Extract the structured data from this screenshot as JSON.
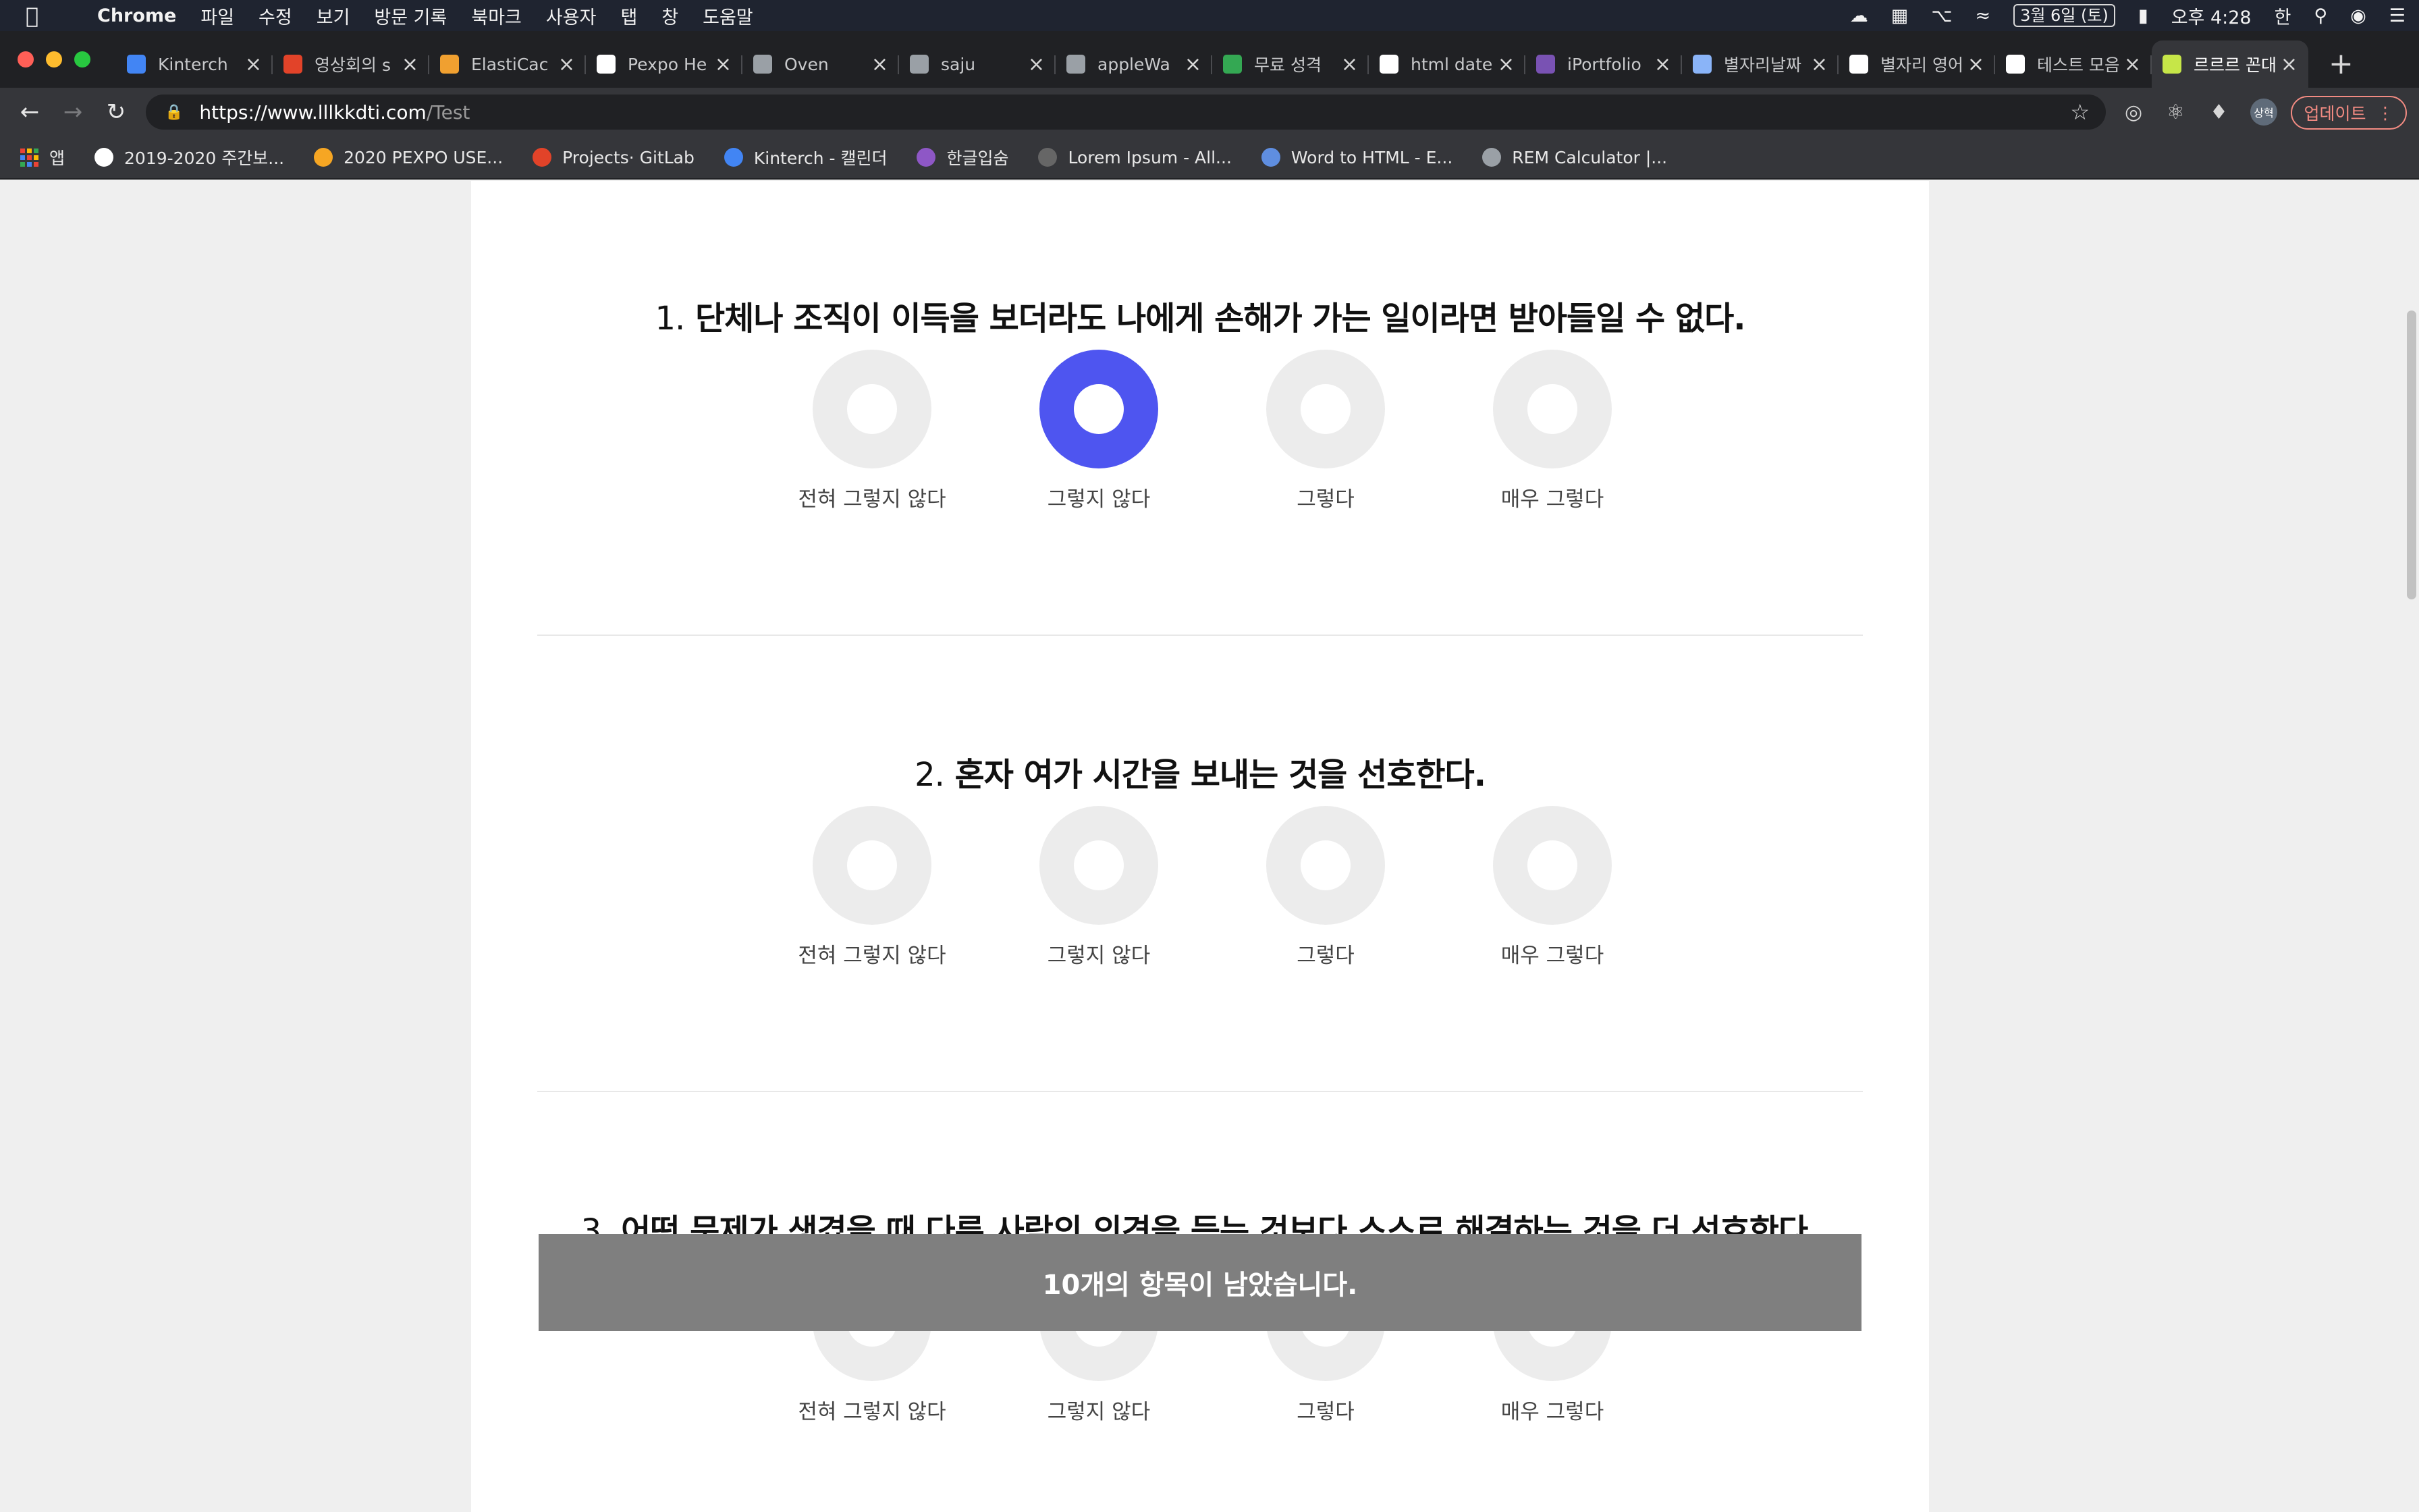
{
  "menubar": {
    "app_name": "Chrome",
    "items": [
      "파일",
      "수정",
      "보기",
      "방문 기록",
      "북마크",
      "사용자",
      "탭",
      "창",
      "도움말"
    ],
    "date": "3월 6일 (토)",
    "time": "오후 4:28",
    "input_method": "한"
  },
  "tabs": [
    {
      "title": "Kinterch",
      "icon": "calendar-icon",
      "color": "#4285f4"
    },
    {
      "title": "영상회의 s",
      "icon": "gitlab-icon",
      "color": "#e24329"
    },
    {
      "title": "ElastiCac",
      "icon": "box-icon",
      "color": "#f0a030"
    },
    {
      "title": "Pexpo He",
      "icon": "pexpo-icon",
      "color": "#ffffff"
    },
    {
      "title": "Oven",
      "icon": "monitor-icon",
      "color": "#9aa0a6"
    },
    {
      "title": "saju",
      "icon": "monitor-icon",
      "color": "#9aa0a6"
    },
    {
      "title": "appleWa",
      "icon": "monitor-icon",
      "color": "#9aa0a6"
    },
    {
      "title": "무료 성격",
      "icon": "spark-icon",
      "color": "#34a853"
    },
    {
      "title": "html date",
      "icon": "google-icon",
      "color": "#ffffff"
    },
    {
      "title": "iPortfolio",
      "icon": "bootstrap-icon",
      "color": "#7952b3"
    },
    {
      "title": "별자리날짜",
      "icon": "image-icon",
      "color": "#8ab4f8"
    },
    {
      "title": "별자리 영어",
      "icon": "google-icon",
      "color": "#ffffff"
    },
    {
      "title": "테스트 모음",
      "icon": "google-icon",
      "color": "#ffffff"
    },
    {
      "title": "르르르 꼰대",
      "icon": "smile-icon",
      "color": "#c6e648",
      "active": true
    }
  ],
  "toolbar": {
    "url_host": "https://www.lllkkdti.com",
    "url_path": "/Test",
    "profile_label": "상혁",
    "update_label": "업데이트"
  },
  "bookmarks": [
    {
      "label": "앱",
      "icon": "apps-grid-icon"
    },
    {
      "label": "2019-2020 주간보...",
      "icon": "google-icon"
    },
    {
      "label": "2020 PEXPO USE...",
      "icon": "pexpo-icon"
    },
    {
      "label": "Projects· GitLab",
      "icon": "gitlab-icon"
    },
    {
      "label": "Kinterch - 캘린더",
      "icon": "calendar-icon"
    },
    {
      "label": "한글입숨",
      "icon": "hangul-icon"
    },
    {
      "label": "Lorem Ipsum - All...",
      "icon": "document-icon"
    },
    {
      "label": "Word to HTML - E...",
      "icon": "code-icon"
    },
    {
      "label": "REM Calculator |...",
      "icon": "calculator-icon"
    }
  ],
  "options": [
    "전혀 그렇지 않다",
    "그렇지 않다",
    "그렇다",
    "매우 그렇다"
  ],
  "questions": [
    {
      "number": "1.",
      "text": "단체나 조직이 이득을 보더라도 나에게 손해가 가는 일이라면 받아들일 수 없다.",
      "selected_index": 1
    },
    {
      "number": "2.",
      "text": "혼자 여가 시간을 보내는 것을 선호한다.",
      "selected_index": null
    },
    {
      "number": "3.",
      "text": "어떤 문제가 생겼을 때 다른 사람의 의견을 듣는 것보다 스스로 해결하는 것을 더 선호한다.",
      "selected_index": null
    }
  ],
  "remaining_banner": "10개의 항목이 남았습니다.",
  "colors": {
    "accent": "#4e55f0",
    "unselected": "#ececec",
    "banner": "#7f7f7f"
  }
}
